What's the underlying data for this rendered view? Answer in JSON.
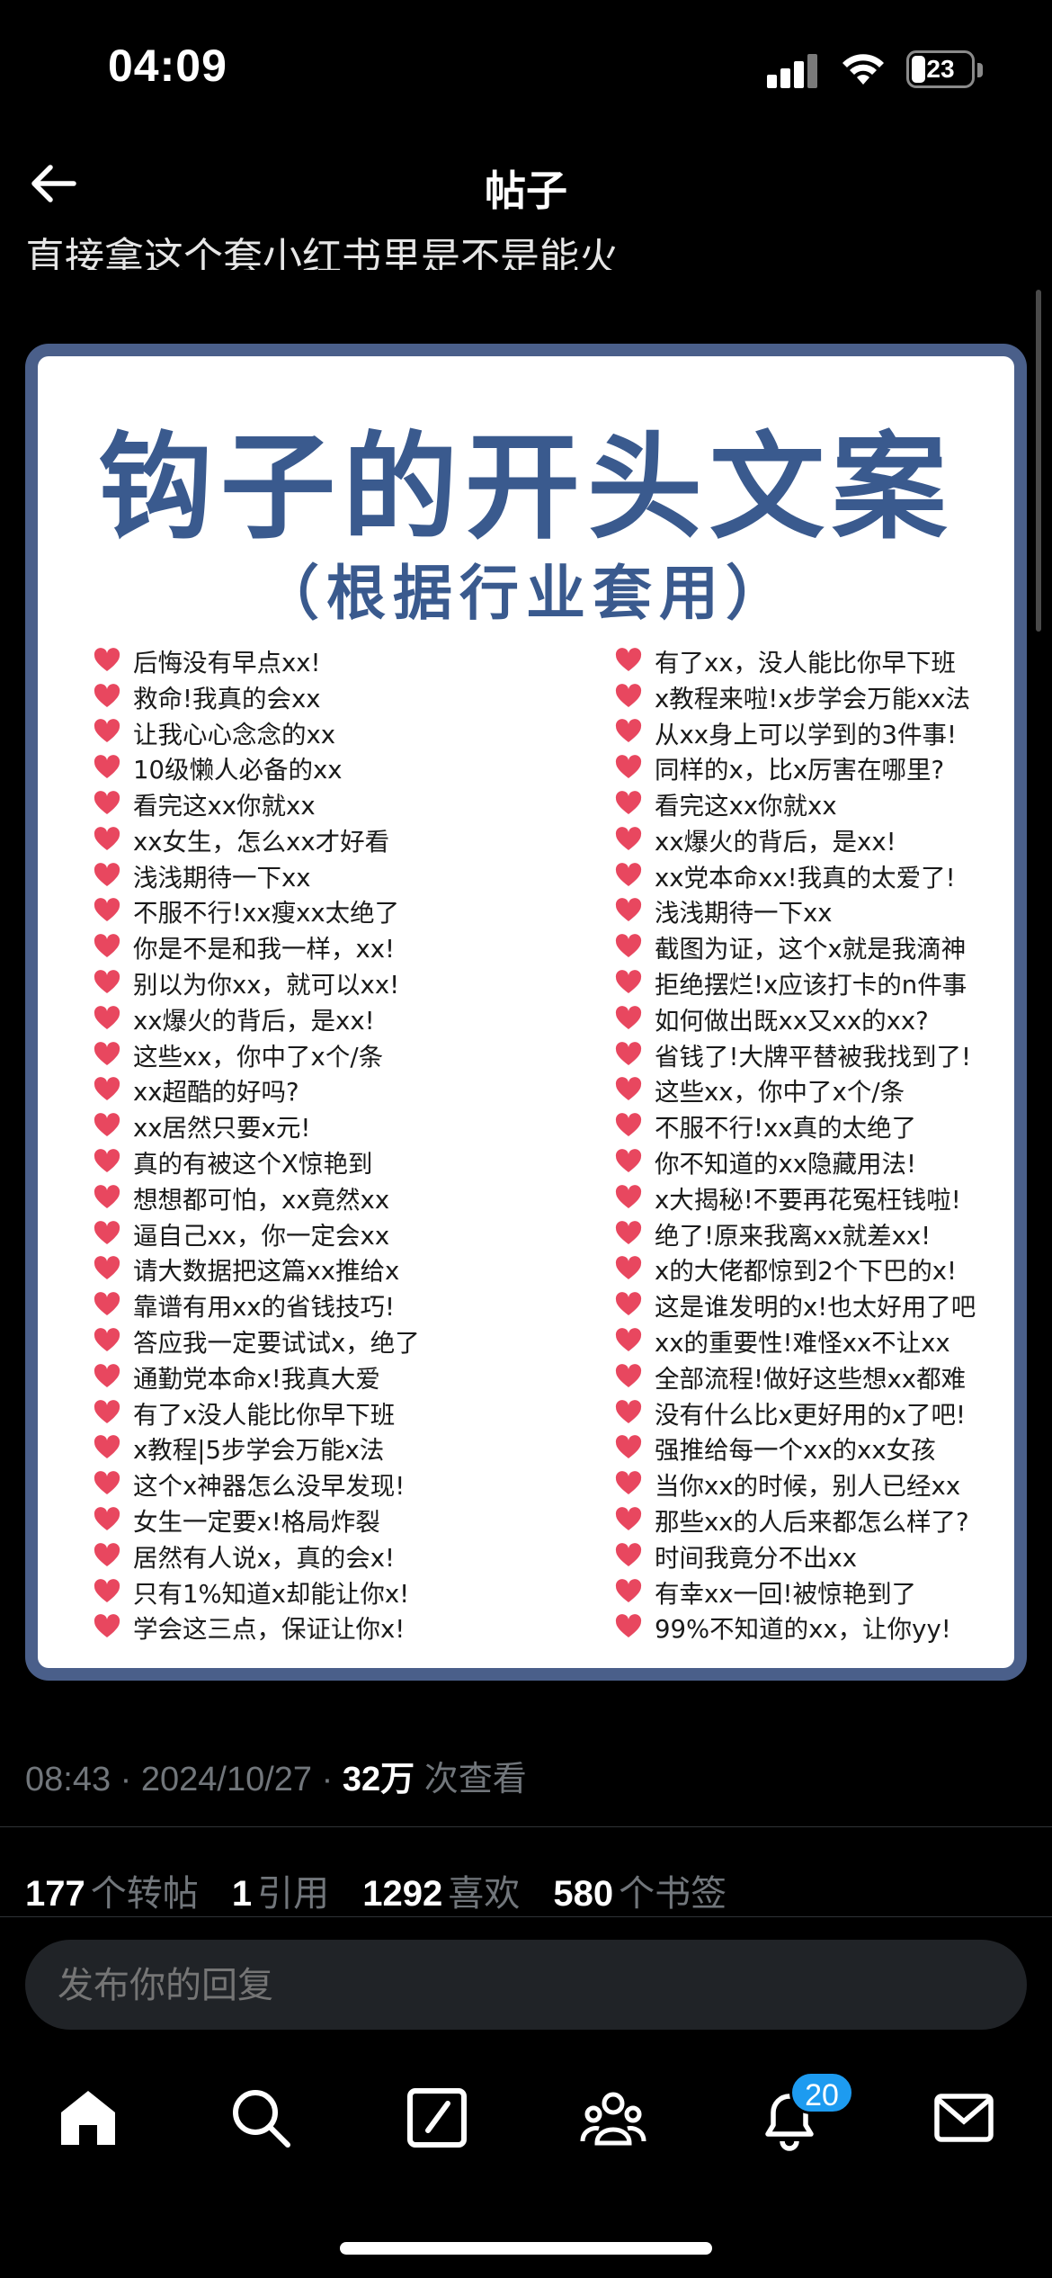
{
  "status_bar": {
    "time": "04:09",
    "battery": "23"
  },
  "nav": {
    "title": "帖子"
  },
  "post": {
    "truncated_text": "直接拿这个套小红书里是不是能火",
    "image": {
      "title": "钩子的开头文案",
      "subtitle": "（根据行业套用）",
      "heart_color": "#e8475f",
      "left_items": [
        "后悔没有早点xx!",
        "救命!我真的会xx",
        "让我心心念念的xx",
        "10级懒人必备的xx",
        "看完这xx你就xx",
        "xx女生，怎么xx才好看",
        "浅浅期待一下xx",
        "不服不行!xx瘦xx太绝了",
        "你是不是和我一样，xx!",
        "别以为你xx，就可以xx!",
        "xx爆火的背后，是xx!",
        "这些xx，你中了x个/条",
        "xx超酷的好吗?",
        "xx居然只要x元!",
        "真的有被这个X惊艳到",
        "想想都可怕，xx竟然xx",
        "逼自己xx，你一定会xx",
        "请大数据把这篇xx推给x",
        "靠谱有用xx的省钱技巧!",
        "答应我一定要试试x，绝了",
        "通勤党本命x!我真大爱",
        "有了x没人能比你早下班",
        "x教程|5步学会万能x法",
        "这个x神器怎么没早发现!",
        "女生一定要x!格局炸裂",
        "居然有人说x，真的会x!",
        "只有1%知道x却能让你x!",
        "学会这三点，保证让你x!"
      ],
      "right_items": [
        "有了xx，没人能比你早下班",
        "x教程来啦!x步学会万能xx法",
        "从xx身上可以学到的3件事!",
        "同样的x，比x厉害在哪里?",
        "看完这xx你就xx",
        "xx爆火的背后，是xx!",
        "xx党本命xx!我真的太爱了!",
        "浅浅期待一下xx",
        "截图为证，这个x就是我滴神",
        "拒绝摆烂!x应该打卡的n件事",
        "如何做出既xx又xx的xx?",
        "省钱了!大牌平替被我找到了!",
        "这些xx，你中了x个/条",
        "不服不行!xx真的太绝了",
        "你不知道的xx隐藏用法!",
        "x大揭秘!不要再花冤枉钱啦!",
        "绝了!原来我离xx就差xx!",
        "x的大佬都惊到2个下巴的x!",
        "这是谁发明的x!也太好用了吧",
        "xx的重要性!难怪xx不让xx",
        "全部流程!做好这些想xx都难",
        "没有什么比x更好用的x了吧!",
        "强推给每一个xx的xx女孩",
        "当你xx的时候，别人已经xx",
        "那些xx的人后来都怎么样了?",
        "时间我竟分不出xx",
        "有幸xx一回!被惊艳到了",
        "99%不知道的xx，让你yy!"
      ]
    },
    "meta": {
      "time": "08:43",
      "date": "2024/10/27",
      "views_count": "32万",
      "views_label": "次查看",
      "separator": " · "
    },
    "stats": [
      {
        "count": "177",
        "label": "个转帖"
      },
      {
        "count": "1",
        "label": "引用"
      },
      {
        "count": "1292",
        "label": "喜欢"
      },
      {
        "count": "580",
        "label": "个书签"
      }
    ]
  },
  "reply": {
    "placeholder": "发布你的回复"
  },
  "tabbar": {
    "notifications_badge": "20",
    "icons": [
      "home-icon",
      "search-icon",
      "compose-icon",
      "communities-icon",
      "bell-icon",
      "mail-icon"
    ]
  },
  "colors": {
    "accent": "#1d9bf0",
    "title_blue": "#3a5a8e",
    "frame": "#4a5f8a"
  }
}
